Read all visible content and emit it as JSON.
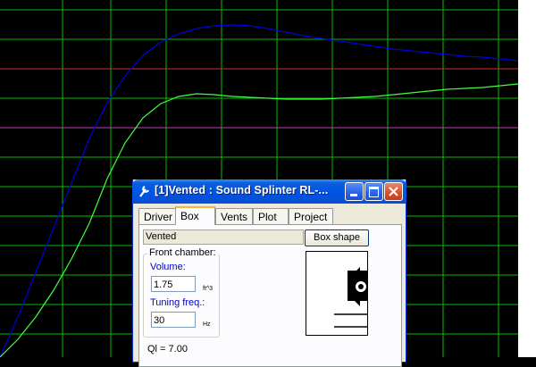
{
  "dialog": {
    "title": "[1]Vented : Sound Splinter RL-...",
    "tabs": [
      "Driver",
      "Box",
      "Vents",
      "Plot",
      "Project"
    ],
    "active_tab": "Box",
    "box_type_value": "Vented",
    "box_shape_button": "Box shape",
    "front_chamber": {
      "group_label": "Front chamber:",
      "volume_label": "Volume:",
      "volume_value": "1.75",
      "volume_unit": "ft^3",
      "tuning_label": "Tuning freq.:",
      "tuning_value": "30",
      "tuning_unit": "Hz"
    },
    "ql_text": "Ql = 7.00"
  },
  "plot": {
    "background": "#000000",
    "grid_color": "#00c000",
    "reference_line_colors": [
      "#d03030",
      "#c040c0"
    ],
    "curve_colors": [
      "#0000e0",
      "#40ff40"
    ]
  }
}
